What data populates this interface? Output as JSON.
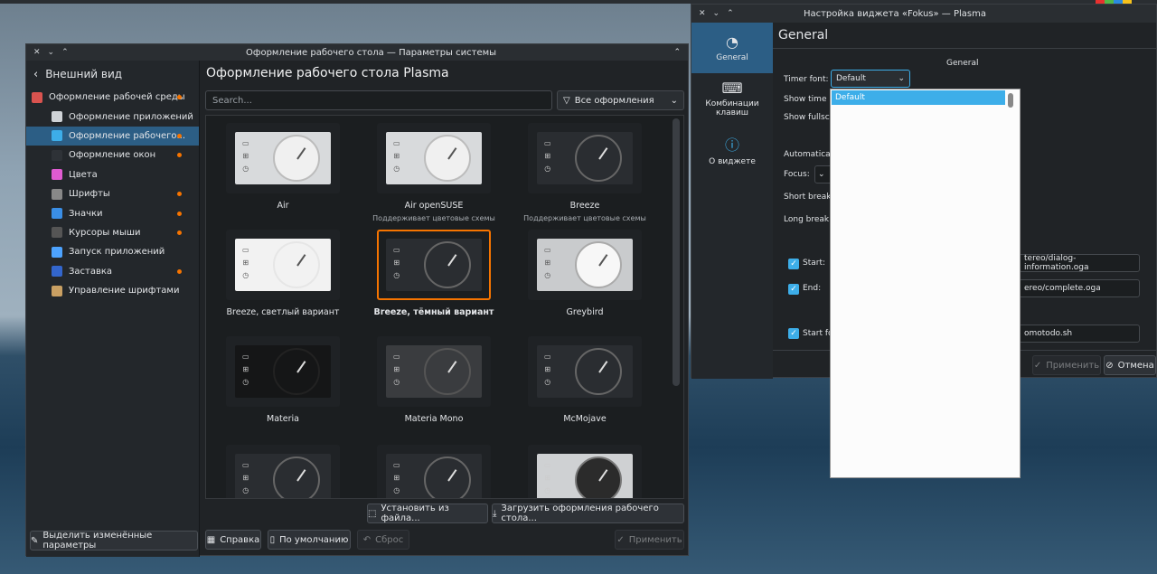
{
  "main_window": {
    "title": "Оформление рабочего стола — Параметры системы",
    "back_label": "Внешний вид",
    "page_title": "Оформление рабочего стола Plasma",
    "search_placeholder": "Search...",
    "filter_value": "Все оформления",
    "sidebar_items": [
      {
        "label": "Оформление рабочей среды",
        "changed": true,
        "indent": false
      },
      {
        "label": "Оформление приложений",
        "changed": false,
        "indent": true
      },
      {
        "label": "Оформление рабочего...",
        "changed": true,
        "indent": true,
        "selected": true
      },
      {
        "label": "Оформление окон",
        "changed": true,
        "indent": true
      },
      {
        "label": "Цвета",
        "changed": false,
        "indent": true
      },
      {
        "label": "Шрифты",
        "changed": true,
        "indent": true
      },
      {
        "label": "Значки",
        "changed": true,
        "indent": true
      },
      {
        "label": "Курсоры мыши",
        "changed": true,
        "indent": true
      },
      {
        "label": "Запуск приложений",
        "changed": false,
        "indent": true
      },
      {
        "label": "Заставка",
        "changed": true,
        "indent": true
      },
      {
        "label": "Управление шрифтами",
        "changed": false,
        "indent": true
      }
    ],
    "themes": [
      {
        "name": "Air",
        "sub": "",
        "style": "light"
      },
      {
        "name": "Air openSUSE",
        "sub": "Поддерживает цветовые схемы",
        "style": "light"
      },
      {
        "name": "Breeze",
        "sub": "Поддерживает цветовые схемы",
        "style": "dark"
      },
      {
        "name": "Breeze, светлый вариант",
        "sub": "",
        "style": "white"
      },
      {
        "name": "Breeze, тёмный вариант",
        "sub": "",
        "style": "dark",
        "selected": true
      },
      {
        "name": "Greybird",
        "sub": "",
        "style": "grey"
      },
      {
        "name": "Materia",
        "sub": "",
        "style": "black"
      },
      {
        "name": "Materia Mono",
        "sub": "",
        "style": "mono"
      },
      {
        "name": "McMojave",
        "sub": "",
        "style": "dark"
      },
      {
        "name": "",
        "sub": "",
        "style": "dark"
      },
      {
        "name": "",
        "sub": "",
        "style": "dark"
      },
      {
        "name": "",
        "sub": "",
        "style": "greylight"
      }
    ],
    "install_file_label": "Установить из файла...",
    "download_label": "Загрузить оформления рабочего стола...",
    "highlight_label": "Выделить изменённые параметры",
    "help_label": "Справка",
    "defaults_label": "По умолчанию",
    "reset_label": "Сброс",
    "apply_label": "Применить"
  },
  "widget_window": {
    "title": "Настройка виджета «Fokus» — Plasma",
    "side": [
      {
        "label": "General",
        "icon": "clock-icon",
        "selected": true
      },
      {
        "label": "Комбинации клавиш",
        "icon": "keyboard-icon"
      },
      {
        "label": "О виджете",
        "icon": "info-icon"
      }
    ],
    "heading": "General",
    "section": "General",
    "timer_font_label": "Timer font:",
    "timer_font_value": "Default",
    "show_time_label": "Show time i",
    "show_full_label": "Show fullscr",
    "automatic_label": "Automatical",
    "focus_label": "Focus:",
    "short_break_label": "Short break:",
    "long_break_label": "Long break:",
    "start_label": "Start:",
    "start_path": "tereo/dialog-information.oga",
    "end_label": "End:",
    "end_path": "ereo/complete.oga",
    "start_fo_label": "Start fo",
    "script_path": "omotodo.sh",
    "apply_label": "Применить",
    "cancel_label": "Отмена",
    "popup_selected": "Default"
  },
  "colors": {
    "accent": "#3daee9",
    "selection": "#2c5e85",
    "changed_dot": "#f67400",
    "theme_highlight": "#f67400"
  }
}
